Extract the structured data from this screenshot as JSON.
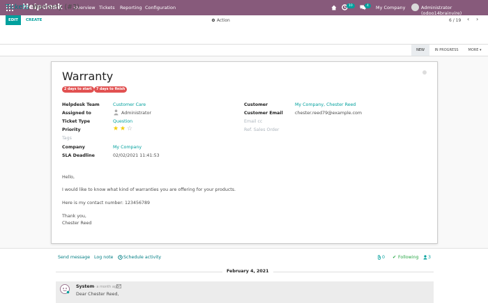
{
  "navbar": {
    "brand": "Helpdesk",
    "menu": [
      "Overview",
      "Tickets",
      "Reporting",
      "Configuration"
    ],
    "activity_count": "10",
    "message_count": "4",
    "company": "My Company",
    "user": "Administrator (odoo14brainvire)",
    "colors": {
      "bar": "#875a7b",
      "badge": "#00a09d"
    }
  },
  "breadcrumb": {
    "parent": "Tickets",
    "separator": "/",
    "current": "Warranty (#3)"
  },
  "toolbar": {
    "edit": "EDIT",
    "create": "CREATE",
    "action": "Action"
  },
  "pager": {
    "value": "6 / 19",
    "prev": "‹",
    "next": "›"
  },
  "stages": {
    "new": "NEW",
    "in_progress": "IN PROGRESS",
    "more": "MORE ▾"
  },
  "ticket": {
    "title": "Warranty",
    "sla_tags": [
      "2 days to start",
      "7 days to finish"
    ],
    "left_fields": {
      "team_label": "Helpdesk Team",
      "team_value": "Customer Care",
      "assigned_label": "Assigned to",
      "assigned_value": "Administrator",
      "type_label": "Ticket Type",
      "type_value": "Question",
      "priority_label": "Priority",
      "priority_stars": 2,
      "tags_label": "Tags",
      "company_label": "Company",
      "company_value": "My Company",
      "deadline_label": "SLA Deadline",
      "deadline_value": "02/02/2021 11:41:53"
    },
    "right_fields": {
      "customer_label": "Customer",
      "customer_value": "My Company, Chester Reed",
      "email_label": "Customer Email",
      "email_value": "chester.reed79@example.com",
      "email_cc_label": "Email cc",
      "ref_label": "Ref. Sales Order"
    },
    "description": [
      "Hello,",
      "I would like to know what kind of warranties you are offering for your products.",
      "Here is my contact number: 123456789",
      "Thank you,",
      "Chester Reed"
    ]
  },
  "chatter": {
    "send_message": "Send message",
    "log_note": "Log note",
    "schedule": "Schedule activity",
    "attachments": "0",
    "following": "Following",
    "followers": "3",
    "date": "February 4, 2021",
    "message": {
      "author": "System",
      "time": "- a month ago",
      "text": "Dear Chester Reed,"
    }
  }
}
